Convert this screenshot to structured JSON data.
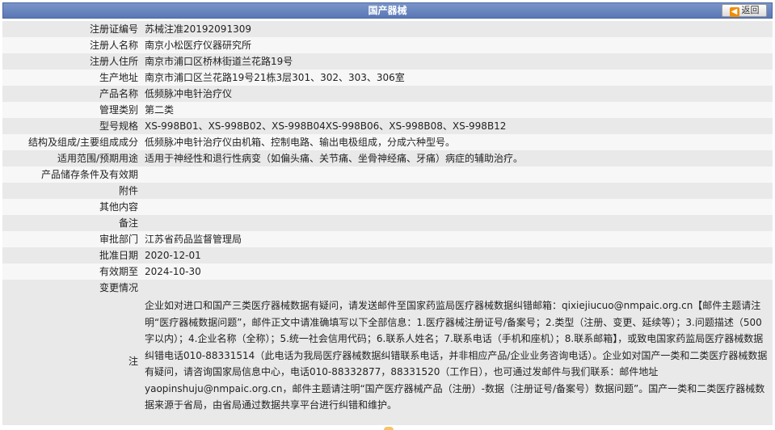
{
  "header": {
    "title": "国产器械",
    "back_label": "返回"
  },
  "fields": [
    {
      "label": "注册证编号",
      "value": "苏械注准20192091309"
    },
    {
      "label": "注册人名称",
      "value": "南京小松医疗仪器研究所"
    },
    {
      "label": "注册人住所",
      "value": "南京市浦口区桥林街道兰花路19号"
    },
    {
      "label": "生产地址",
      "value": "南京市浦口区兰花路19号21栋3层301、302、303、306室"
    },
    {
      "label": "产品名称",
      "value": "低频脉冲电针治疗仪"
    },
    {
      "label": "管理类别",
      "value": "第二类"
    },
    {
      "label": "型号规格",
      "value": "XS-998B01、XS-998B02、XS-998B04XS-998B06、XS-998B08、XS-998B12"
    },
    {
      "label": "结构及组成/主要组成成分",
      "value": "低频脉冲电针治疗仪由机箱、控制电路、输出电极组成，分成六种型号。"
    },
    {
      "label": "适用范围/预期用途",
      "value": "适用于神经性和退行性病变（如偏头痛、关节痛、坐骨神经痛、牙痛）病症的辅助治疗。"
    },
    {
      "label": "产品储存条件及有效期",
      "value": ""
    },
    {
      "label": "附件",
      "value": ""
    },
    {
      "label": "其他内容",
      "value": ""
    },
    {
      "label": "备注",
      "value": ""
    },
    {
      "label": "审批部门",
      "value": "江苏省药品监督管理局"
    },
    {
      "label": "批准日期",
      "value": "2020-12-01"
    },
    {
      "label": "有效期至",
      "value": "2024-10-30"
    },
    {
      "label": "变更情况",
      "value": ""
    }
  ],
  "note": {
    "label": "注",
    "text": "企业如对进口和国产三类医疗器械数据有疑问，请发送邮件至国家药监局医疗器械数据纠错邮箱：qixiejiucuo@nmpaic.org.cn【邮件主题请注明“医疗器械数据问题”，邮件正文中请准确填写以下全部信息：1.医疗器械注册证号/备案号；2.类型（注册、变更、延续等）；3.问题描述（500字以内）；4.企业名称（全称）；5.统一社会信用代码；6.联系人姓名；7.联系电话（手机和座机）；8.联系邮箱】，或致电国家药监局医疗器械数据纠错电话010-88331514（此电话为我局医疗器械数据纠错联系电话，并非相应产品/企业业务咨询电话）。企业如对国产一类和二类医疗器械数据有疑问，请咨询国家局信息中心，电话010-88332877，88331520（工作日），也可通过发邮件与我们联系：邮件地址yaopinshuju@nmpaic.org.cn，邮件主题请注明“国产医疗器械产品（注册）-数据（注册证号/备案号）数据问题”。国产一类和二类医疗器械数据来源于省局，由省局通过数据共享平台进行纠错和维护。"
  }
}
